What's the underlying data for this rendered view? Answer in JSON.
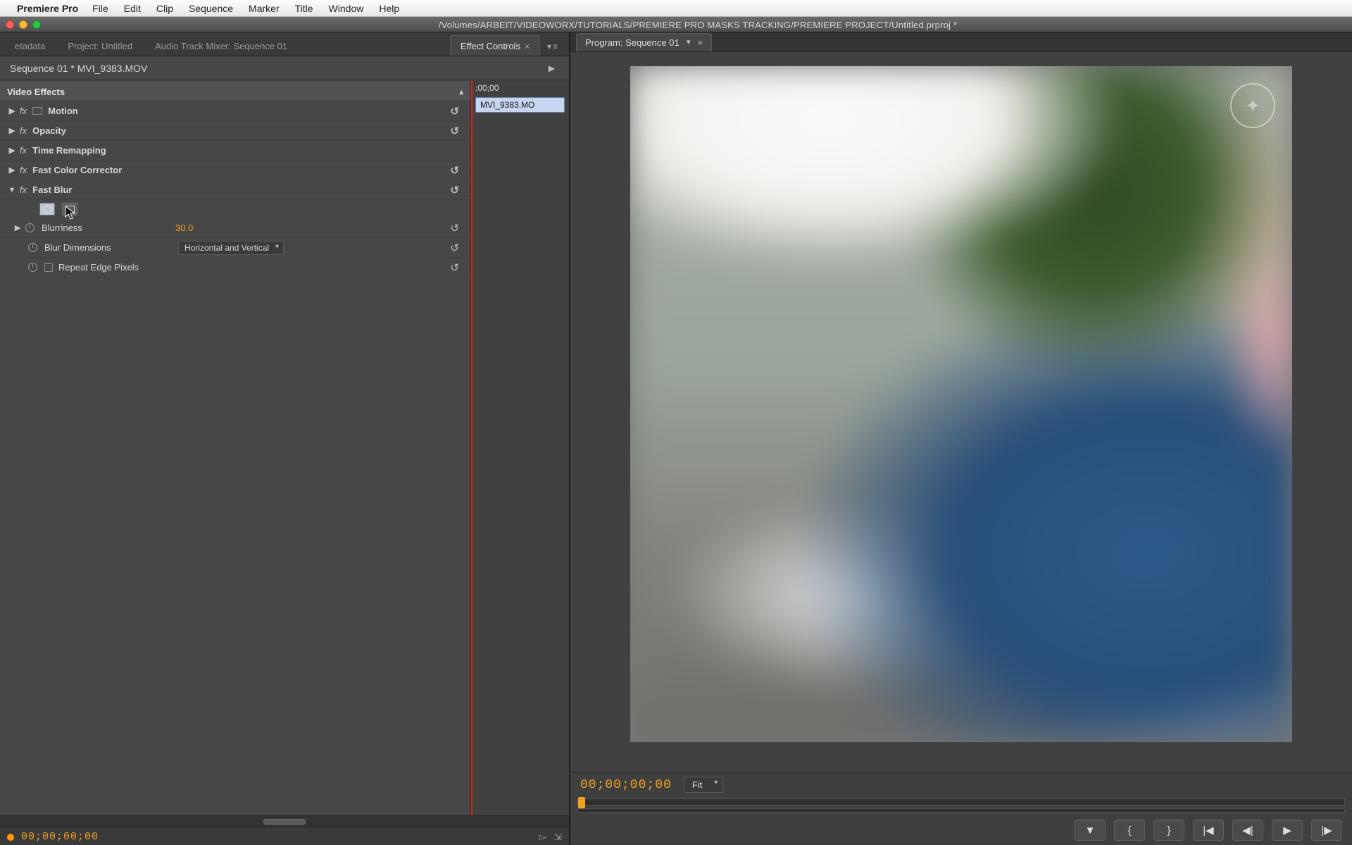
{
  "menubar": {
    "app_name": "Premiere Pro",
    "items": [
      "File",
      "Edit",
      "Clip",
      "Sequence",
      "Marker",
      "Title",
      "Window",
      "Help"
    ]
  },
  "window": {
    "title_path": "/Volumes/ARBEIT/VIDEOWORX/TUTORIALS/PREMIERE PRO MASKS TRACKING/PREMIERE PROJECT/Untitled.prproj *"
  },
  "left_tabs": {
    "items": [
      {
        "label": "etadata",
        "active": false
      },
      {
        "label": "Project: Untitled",
        "active": false
      },
      {
        "label": "Audio Track Mixer: Sequence 01",
        "active": false
      },
      {
        "label": "Effect Controls",
        "active": true
      }
    ]
  },
  "effect_controls": {
    "header": "Sequence 01 * MVI_9383.MOV",
    "timelane_tc": ":00;00",
    "timelane_clip": "MVI_9383.MO",
    "section": "Video Effects",
    "effects": [
      {
        "name": "Motion",
        "expanded": false,
        "has_reset": true,
        "has_bypass_box": true
      },
      {
        "name": "Opacity",
        "expanded": false,
        "has_reset": true,
        "has_bypass_box": false
      },
      {
        "name": "Time Remapping",
        "expanded": false,
        "has_reset": false,
        "has_bypass_box": false
      },
      {
        "name": "Fast Color Corrector",
        "expanded": false,
        "has_reset": true,
        "has_bypass_box": false
      },
      {
        "name": "Fast Blur",
        "expanded": true,
        "has_reset": true,
        "has_bypass_box": false
      }
    ],
    "fast_blur": {
      "blurriness_label": "Blurriness",
      "blurriness_value": "30.0",
      "blur_dimensions_label": "Blur Dimensions",
      "blur_dimensions_value": "Horizontal and Vertical",
      "repeat_edge_label": "Repeat Edge Pixels",
      "repeat_edge_checked": false
    },
    "footer_tc": "00;00;00;00"
  },
  "program_monitor": {
    "tab_label": "Program: Sequence 01",
    "footer_tc": "00;00;00;00",
    "zoom_label": "Fit"
  },
  "transport": {
    "buttons": [
      "mark-in",
      "mark-out",
      "go-in",
      "go-out",
      "step-back",
      "play",
      "step-fwd"
    ]
  }
}
